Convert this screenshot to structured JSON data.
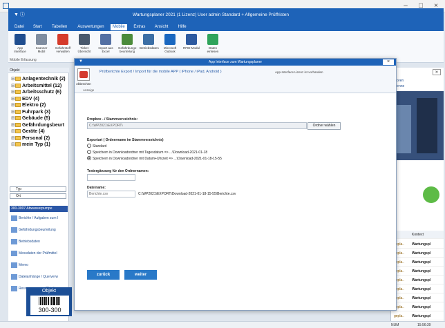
{
  "window": {
    "title": "Wartungsplaner 2021 (1 Lizenz)   User admin   Standard + Allgemeine Prüffristen"
  },
  "menu": [
    "Datei",
    "Start",
    "Tabellen",
    "Auswertungen",
    "Mobile",
    "Extras",
    "Ansicht",
    "Hilfe"
  ],
  "menu_active": "Mobile",
  "ribbon": {
    "buttons": [
      {
        "label": "App Interface",
        "icon": "phone-icon",
        "color": "#1f4d8f"
      },
      {
        "label": "Scanner Mobil",
        "icon": "scanner-icon",
        "color": "#7f8da0"
      },
      {
        "label": "Gefahrstoff verwalten",
        "icon": "hazard-icon",
        "color": "#d53b2b"
      },
      {
        "label": "Ticket Übersicht",
        "icon": "clipboard-icon",
        "color": "#4a5a6e"
      },
      {
        "label": "Import aus Excel",
        "icon": "grid-icon",
        "color": "#5470a3"
      },
      {
        "label": "Gefährdungs-beurteilung",
        "icon": "chart-icon",
        "color": "#4b8b3b"
      },
      {
        "label": "Betriebsdaten",
        "icon": "factory-icon",
        "color": "#3b6ea5"
      },
      {
        "label": "Microsoft Outlook",
        "icon": "outlook-icon",
        "color": "#1967c0"
      },
      {
        "label": "RFID Modul",
        "icon": "rfid-icon",
        "color": "#2d5aa0"
      },
      {
        "label": "Daten einlesen",
        "icon": "sync-icon",
        "color": "#2fa45b"
      }
    ],
    "group": "Mobile Erfassung"
  },
  "leftpane": {
    "header": "Objekt",
    "tree": [
      "Anlagentechnik (2)",
      "Arbeitsmittel (12)",
      "Arbeitsschutz (6)",
      "EDV (4)",
      "Elektro (2)",
      "Fuhrpark (3)",
      "Gebäude (5)",
      "Gefährdungsbeurt",
      "Geräte (4)",
      "Personal (2)",
      "mein Typ (1)"
    ],
    "combo1": "Typ",
    "combo2": "Ort",
    "blue_header": "300-3007 Abwasserpumpe",
    "list": [
      "Berichte / Aufgaben zum I",
      "Gefährdungsbeurteilung",
      "Betriebsdaten",
      "Messdaten der Prüfmittel",
      "Memo",
      "Dateianhänge / Querverw",
      "Ressourcen zum Objekt"
    ],
    "barcode_label": "Objekt",
    "barcode_number": "300-300"
  },
  "dialog": {
    "title": "App Interface zum Wartungsplaner",
    "ribbon_btn": "Abbrechen",
    "ribbon_group": "Anzeige",
    "heading": "Prüfberichte Export / Import für die mobile APP ( iPhone / iPad, Android )",
    "license_note": "App-Interface Lizenz ist vorhanden",
    "dropbox_label": "Dropbox - / Stammverzeichnis:",
    "dropbox_value": "C:\\WP2021\\EXPORT\\",
    "select_folder": "Ordner wählen",
    "export_label": "Exportart ( Ordnername im Stammverzeichnis)",
    "radios": [
      "Standard",
      "Speichern in Downloadordner mit Tagesdatum =>  ...\\Download-2021-01-18",
      "Speichern in Downloadordner mit Datum+Uhrzeit =>  ...\\Download-2021-01-18-15-55"
    ],
    "radio_selected": 2,
    "text_label": "Textergänzung für den Ordnernamen:",
    "text_value": "",
    "file_label": "Dateiname:",
    "file_value": "Berichte.csv",
    "file_path": "C:\\WP2021\\EXPORT\\Download-2021-01-18-15-55\\Berichte.csv",
    "back": "zurück",
    "next": "weiter"
  },
  "rightpane": {
    "text_top": [
      "ntoren",
      "nfenne"
    ],
    "col_header": "Kontext",
    "rows": [
      [
        "gepla..",
        "Wartungspl"
      ],
      [
        "gepla..",
        "Wartungspl"
      ],
      [
        "gepla..",
        "Wartungspl"
      ],
      [
        "gepla..",
        "Wartungspl"
      ],
      [
        "gepla..",
        "Wartungspl"
      ],
      [
        "gepla..",
        "Wartungspl"
      ],
      [
        "gepla..",
        "Wartungspl"
      ],
      [
        "gepla..",
        "Wartungspl"
      ],
      [
        "gepla..",
        "Wartungspl"
      ]
    ]
  },
  "status": {
    "num": "NUM",
    "time": "15:56:39"
  }
}
